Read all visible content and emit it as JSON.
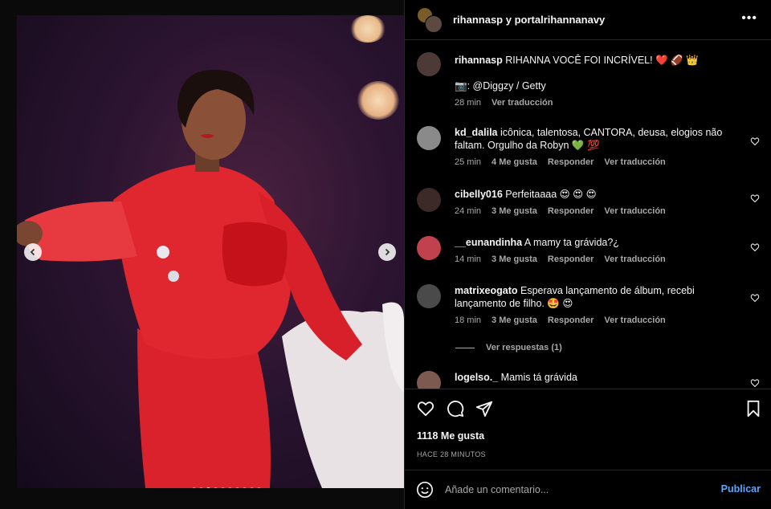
{
  "header": {
    "title": "rihannasp y portalrihannanavy",
    "more_label": "•••"
  },
  "caption": {
    "user": "rihannasp",
    "text": "RIHANNA VOCÊ FOI INCRÍVEL! ❤️ 🏈 👑",
    "credit": "📷: @Diggzy / Getty",
    "time": "28 min",
    "translate": "Ver traducción"
  },
  "comments": [
    {
      "user": "kd_dalila",
      "text": "icônica, talentosa, CANTORA, deusa, elogios não faltam. Orgulho da Robyn 💚 💯",
      "time": "25 min",
      "likes": "4 Me gusta",
      "reply": "Responder",
      "translate": "Ver traducción",
      "avatar_color": "#8a8a8a"
    },
    {
      "user": "cibelly016",
      "text": "Perfeitaaaa 😍 😍 😍",
      "time": "24 min",
      "likes": "3 Me gusta",
      "reply": "Responder",
      "translate": "Ver traducción",
      "avatar_color": "#3b2a28"
    },
    {
      "user": "__eunandinha",
      "text": "A mamy ta grávida?¿",
      "time": "14 min",
      "likes": "3 Me gusta",
      "reply": "Responder",
      "translate": "Ver traducción",
      "avatar_color": "#c2414f"
    },
    {
      "user": "matrixeogato",
      "text": "Esperava lançamento de álbum, recebi lançamento de filho. 🤩 😍",
      "time": "18 min",
      "likes": "3 Me gusta",
      "reply": "Responder",
      "translate": "Ver traducción",
      "avatar_color": "#4a4a4a"
    },
    {
      "user": "logelso._",
      "text": "Mamis tá grávida",
      "avatar_color": "#7d5a4f"
    }
  ],
  "view_replies": "Ver respuestas (1)",
  "likes_count": "1118 Me gusta",
  "posted": "HACE 28 MINUTOS",
  "comment_input": {
    "placeholder": "Añade un comentario..."
  },
  "publish_label": "Publicar",
  "carousel": {
    "total": 10,
    "active": 2
  },
  "colors": {
    "accent": "#5aa6ff",
    "outfit_red": "#e0262e",
    "heart_green": "#2fbf4f"
  }
}
